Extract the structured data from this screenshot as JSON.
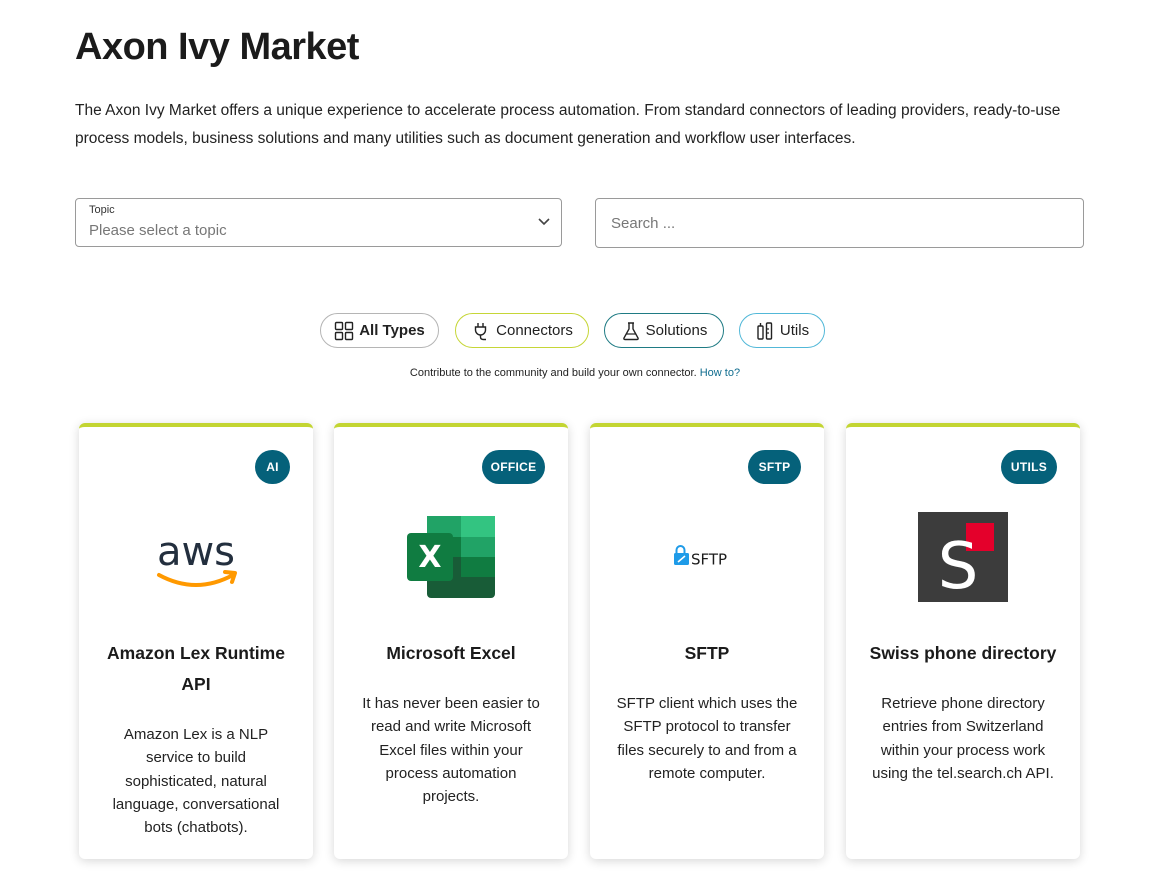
{
  "header": {
    "title": "Axon Ivy Market",
    "description": "The Axon Ivy Market offers a unique experience to accelerate process automation. From standard connectors of leading providers, ready-to-use process models, business solutions and many utilities such as document generation and workflow user interfaces."
  },
  "topic": {
    "label": "Topic",
    "placeholder": "Please select a topic"
  },
  "search": {
    "placeholder": "Search ..."
  },
  "filters": [
    {
      "label": "All Types",
      "icon": "grid-icon"
    },
    {
      "label": "Connectors",
      "icon": "plug-icon"
    },
    {
      "label": "Solutions",
      "icon": "flask-icon"
    },
    {
      "label": "Utils",
      "icon": "tools-icon"
    }
  ],
  "contribute": {
    "text": "Contribute to the community and build your own connector.",
    "link": "How to?"
  },
  "cards": [
    {
      "badge": "AI",
      "logo": "aws-logo",
      "title": "Amazon Lex Runtime API",
      "description": "Amazon Lex is a NLP service to build sophisticated, natural language, conversational bots (chatbots)."
    },
    {
      "badge": "OFFICE",
      "logo": "excel-logo",
      "title": "Microsoft Excel",
      "description": "It has never been easier to read and write Microsoft Excel files within your process automation projects."
    },
    {
      "badge": "SFTP",
      "logo": "sftp-logo",
      "title": "SFTP",
      "description": "SFTP client which uses the SFTP protocol to transfer files securely to and from a remote computer."
    },
    {
      "badge": "UTILS",
      "logo": "search-ch-logo",
      "title": "Swiss phone directory",
      "description": "Retrieve phone directory entries from Switzerland within your process work using the tel.search.ch API."
    }
  ],
  "logo_text": {
    "aws": "aws",
    "excel": "X",
    "sftp": "SFTP",
    "search_ch": "S"
  },
  "colors": {
    "accent_lime": "#c3d532",
    "badge_teal": "#05617a",
    "link": "#0f6c8e"
  }
}
